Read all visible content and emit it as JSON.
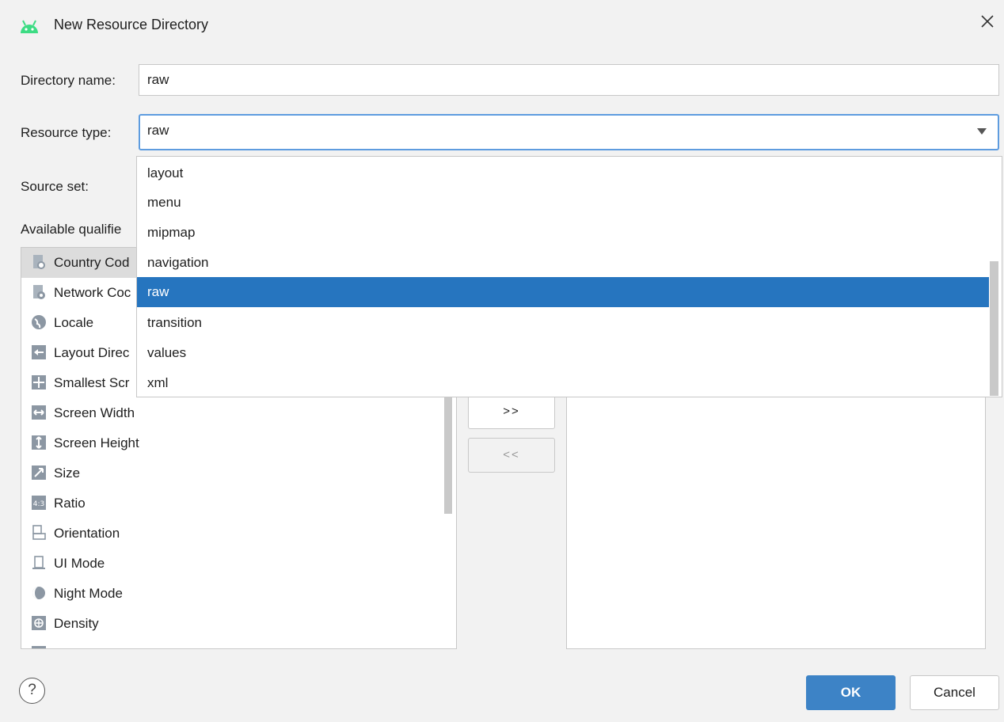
{
  "window": {
    "title": "New Resource Directory"
  },
  "form": {
    "directory_name_label": "Directory name:",
    "directory_name_value": "raw",
    "resource_type_label": "Resource type:",
    "resource_type_value": "raw",
    "source_set_label": "Source set:",
    "available_qualifiers_label": "Available qualifie"
  },
  "resource_type_options": [
    "layout",
    "menu",
    "mipmap",
    "navigation",
    "raw",
    "transition",
    "values",
    "xml"
  ],
  "qualifiers": [
    {
      "label": "Country Cod",
      "icon": "country-code-icon"
    },
    {
      "label": "Network Coc",
      "icon": "network-code-icon"
    },
    {
      "label": "Locale",
      "icon": "globe-icon"
    },
    {
      "label": "Layout Direc",
      "icon": "layout-direction-icon"
    },
    {
      "label": "Smallest Scr",
      "icon": "smallest-screen-icon"
    },
    {
      "label": "Screen Width",
      "icon": "screen-width-icon"
    },
    {
      "label": "Screen Height",
      "icon": "screen-height-icon"
    },
    {
      "label": "Size",
      "icon": "size-icon"
    },
    {
      "label": "Ratio",
      "icon": "ratio-icon"
    },
    {
      "label": "Orientation",
      "icon": "orientation-icon"
    },
    {
      "label": "UI Mode",
      "icon": "ui-mode-icon"
    },
    {
      "label": "Night Mode",
      "icon": "night-mode-icon"
    },
    {
      "label": "Density",
      "icon": "density-icon"
    }
  ],
  "buttons": {
    "add": ">>",
    "remove": "<<",
    "ok": "OK",
    "cancel": "Cancel",
    "help": "?"
  },
  "colors": {
    "accent": "#2675bf",
    "ok": "#3d83c6",
    "android": "#3ddc84"
  }
}
